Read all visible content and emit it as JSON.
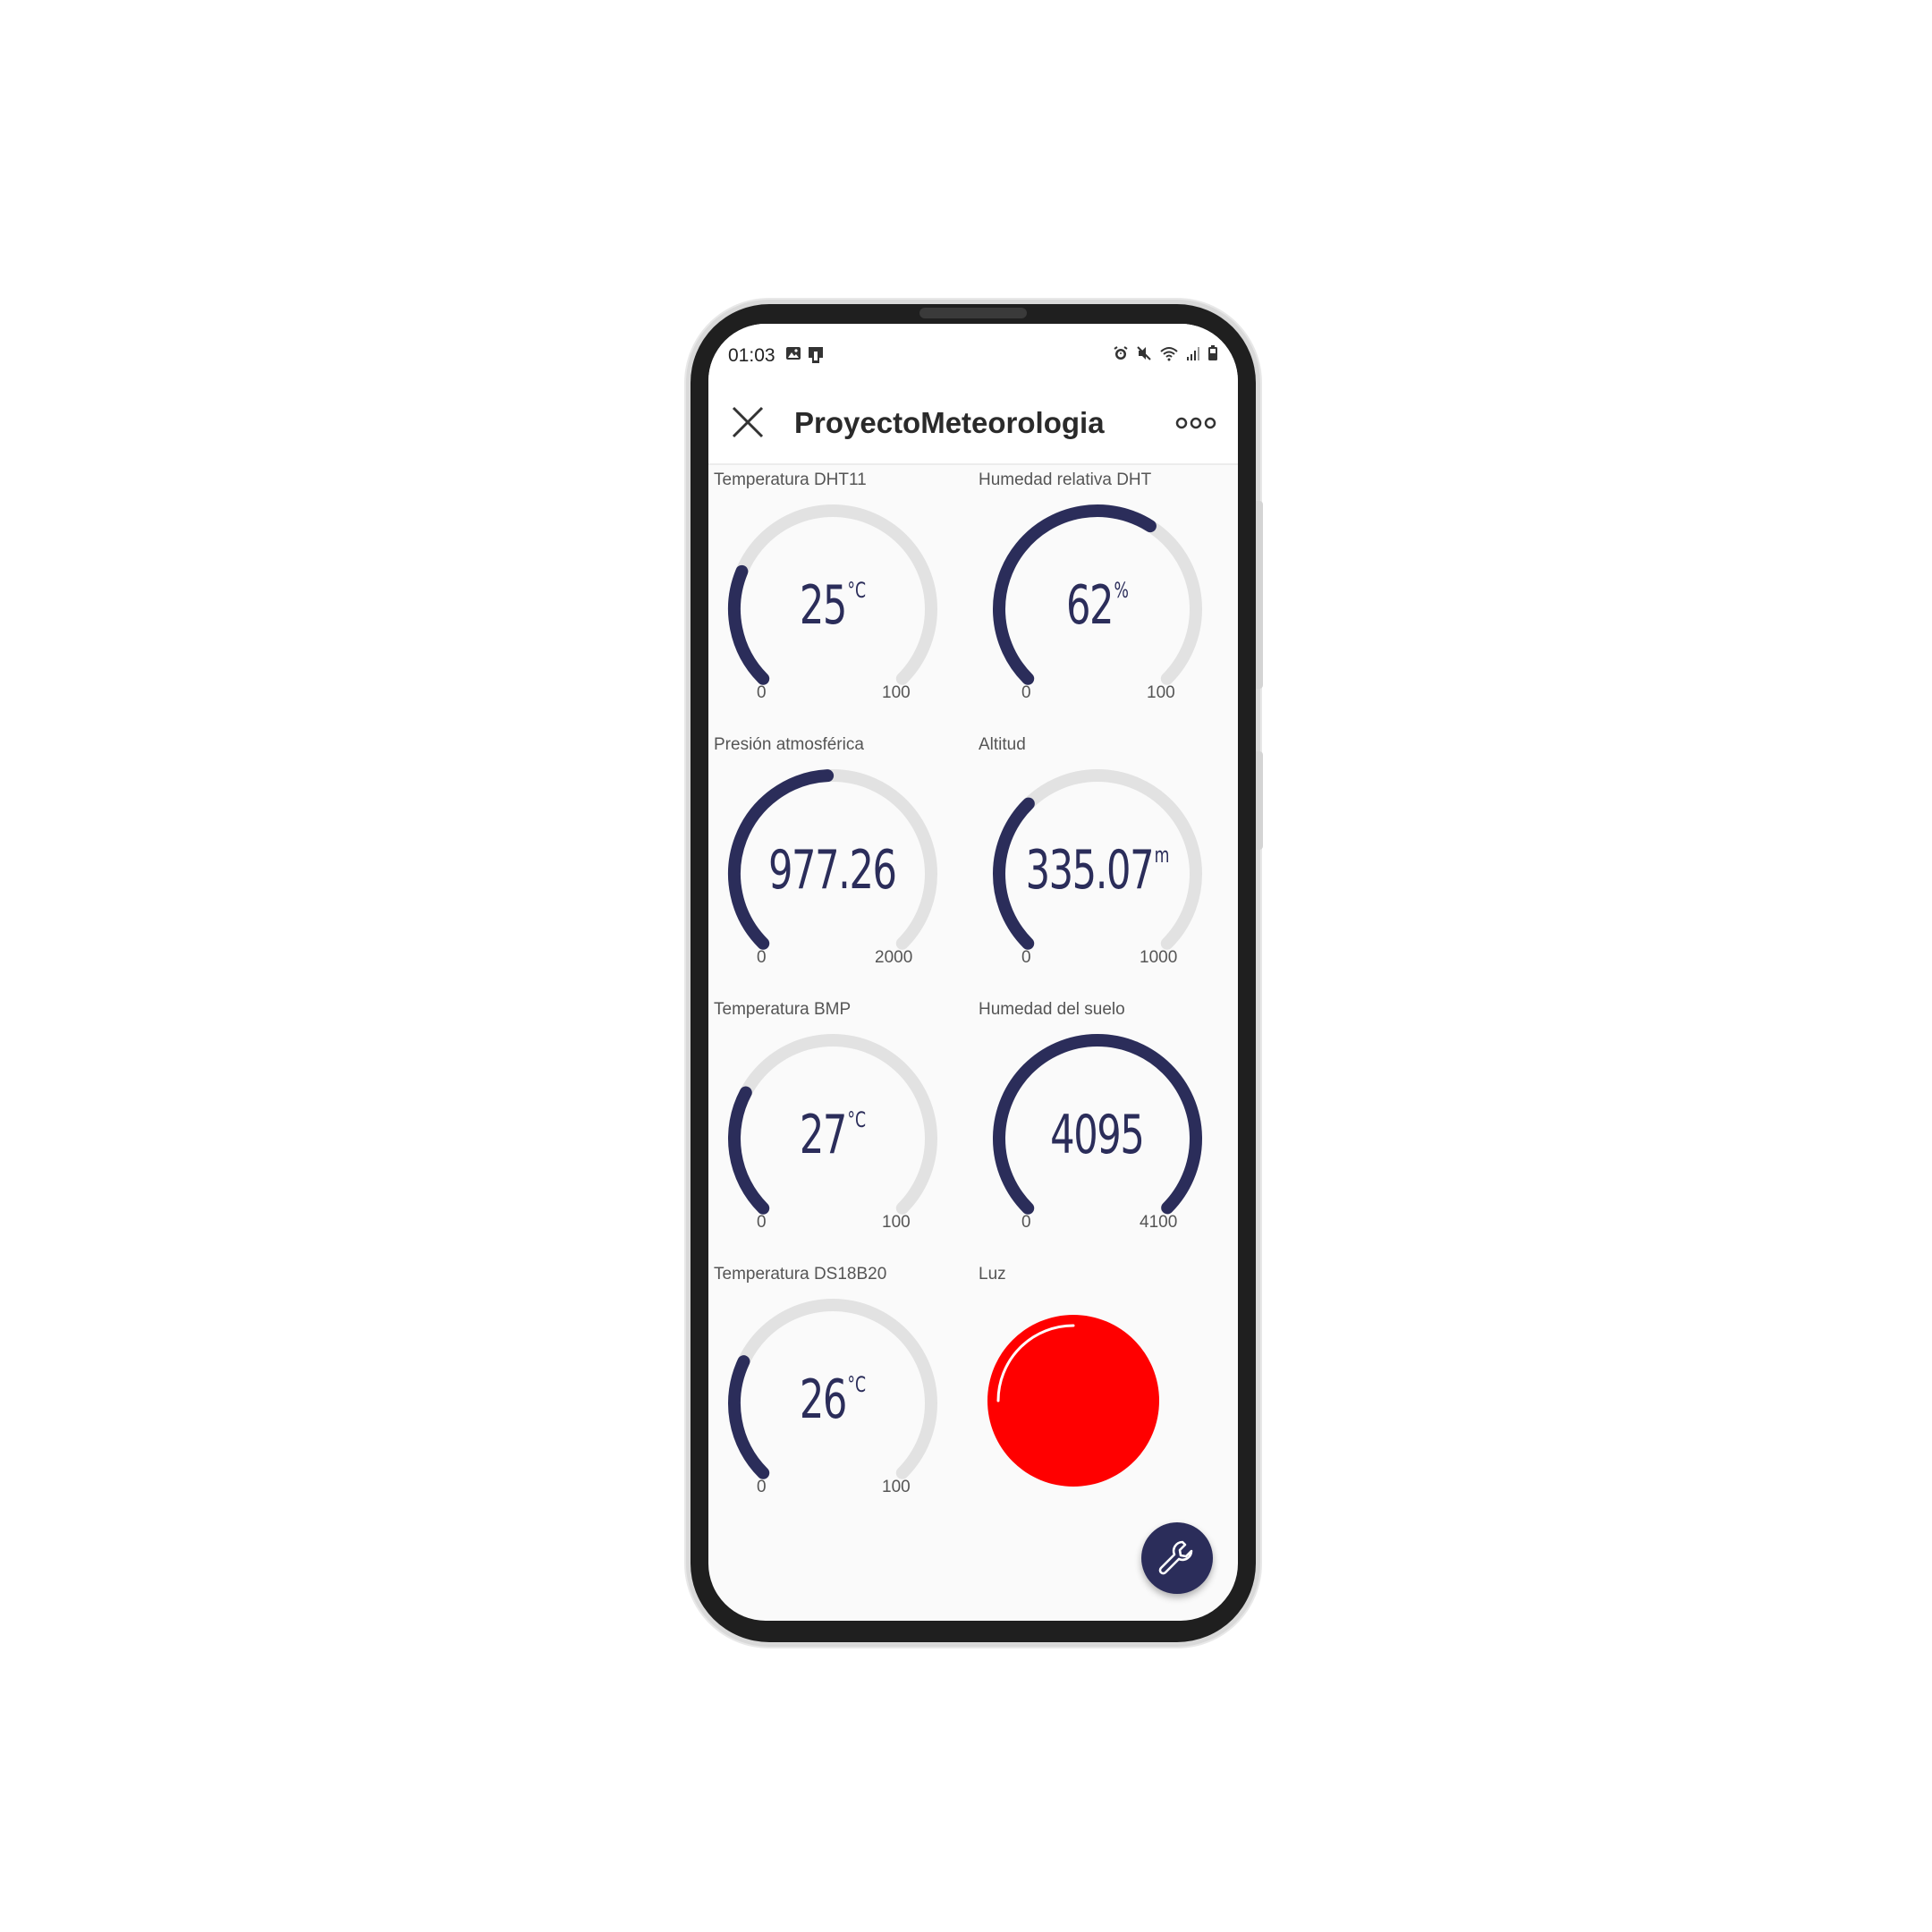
{
  "status_bar": {
    "time": "01:03",
    "left_icons": [
      "image-icon",
      "cast-icon"
    ],
    "right_icons": [
      "alarm-icon",
      "mute-icon",
      "wifi-icon",
      "signal-icon",
      "battery-icon"
    ]
  },
  "app_bar": {
    "title": "ProyectoMeteorologia",
    "close_icon": "close-icon",
    "more_icon": "more-icon"
  },
  "colors": {
    "accent": "#2b2d5a",
    "track": "#e2e2e2",
    "led_on": "#ff0000",
    "background": "#fafafa"
  },
  "widgets": [
    {
      "label": "Temperatura DHT11",
      "value": "25",
      "unit": "°C",
      "min": "0",
      "max": "100",
      "numeric_value": 25,
      "range": [
        0,
        100
      ]
    },
    {
      "label": "Humedad relativa DHT",
      "value": "62",
      "unit": "%",
      "min": "0",
      "max": "100",
      "numeric_value": 62,
      "range": [
        0,
        100
      ]
    },
    {
      "label": "Presión atmosférica",
      "value": "977.26",
      "unit": "",
      "min": "0",
      "max": "2000",
      "numeric_value": 977.26,
      "range": [
        0,
        2000
      ]
    },
    {
      "label": "Altitud",
      "value": "335.07",
      "unit": "m",
      "min": "0",
      "max": "1000",
      "numeric_value": 335.07,
      "range": [
        0,
        1000
      ]
    },
    {
      "label": "Temperatura BMP",
      "value": "27",
      "unit": "°C",
      "min": "0",
      "max": "100",
      "numeric_value": 27,
      "range": [
        0,
        100
      ]
    },
    {
      "label": "Humedad del suelo",
      "value": "4095",
      "unit": "",
      "min": "0",
      "max": "4100",
      "numeric_value": 4095,
      "range": [
        0,
        4100
      ]
    },
    {
      "label": "Temperatura DS18B20",
      "value": "26",
      "unit": "°C",
      "min": "0",
      "max": "100",
      "numeric_value": 26,
      "range": [
        0,
        100
      ]
    }
  ],
  "led": {
    "label": "Luz",
    "state": "on"
  },
  "fab": {
    "icon": "wrench-icon"
  }
}
